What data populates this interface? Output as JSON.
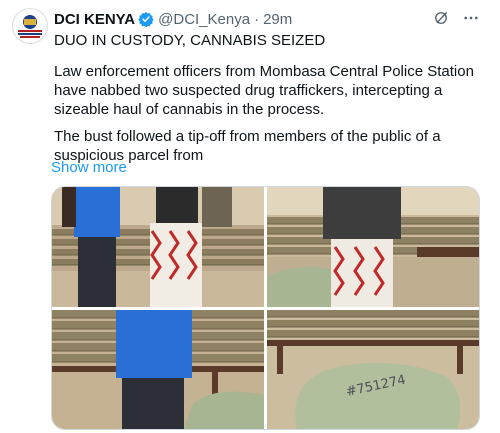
{
  "tweet": {
    "author_name": "DCI KENYA",
    "handle": "@DCI_Kenya",
    "separator": "·",
    "time": "29m",
    "headline": "DUO IN CUSTODY, CANNABIS SEIZED",
    "paragraph1": "Law enforcement officers from Mombasa Central Police Station have nabbed two suspected drug traffickers, intercepting a sizeable haul of cannabis in the process.",
    "paragraph2": "The bust followed a tip-off from members of the public of a suspicious parcel from",
    "show_more": "Show more"
  },
  "icons": {
    "verified": "verified-badge-icon",
    "grok": "grok-icon",
    "more": "more-icon"
  },
  "colors": {
    "accent": "#1d9bf0",
    "secondary_text": "#536471",
    "primary_text": "#0f1419"
  },
  "media": {
    "photo_count": 4,
    "parcel_marking": "#751274"
  }
}
